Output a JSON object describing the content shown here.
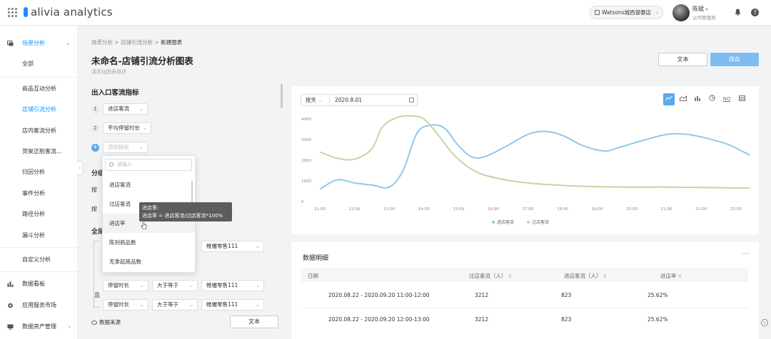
{
  "header": {
    "logo": "alivia analytics",
    "store": "Watsons城西银泰店",
    "user_name": "陈斌",
    "user_role": "公司管理员"
  },
  "sidebar": {
    "items": [
      {
        "label": "场景分析",
        "type": "group",
        "active": true
      },
      {
        "label": "全部",
        "type": "sub"
      },
      {
        "label": "商品互动分析",
        "type": "sub"
      },
      {
        "label": "店铺引流分析",
        "type": "sub",
        "active": true
      },
      {
        "label": "店内客流分析",
        "type": "sub"
      },
      {
        "label": "货架正脸客流...",
        "type": "sub"
      },
      {
        "label": "归因分析",
        "type": "sub"
      },
      {
        "label": "事件分析",
        "type": "sub"
      },
      {
        "label": "路径分析",
        "type": "sub"
      },
      {
        "label": "漏斗分析",
        "type": "sub"
      },
      {
        "label": "自定义分析",
        "type": "sub"
      },
      {
        "label": "数据看板",
        "type": "top"
      },
      {
        "label": "应用服务市场",
        "type": "top"
      },
      {
        "label": "数据资产管理",
        "type": "top"
      }
    ]
  },
  "breadcrumb": {
    "items": [
      "场景分析",
      "店铺引流分析",
      "新建图表"
    ],
    "sep": ">"
  },
  "page": {
    "title": "未命名-店铺引流分析图表",
    "desc_placeholder": "请添加图表描述",
    "text_btn": "文本",
    "save_btn": "保存"
  },
  "metrics": {
    "section_title": "出入口客流指标",
    "items": [
      {
        "num": "1",
        "label": "进店客流"
      },
      {
        "num": "2",
        "label": "平均停留时长"
      }
    ],
    "add_placeholder": "添加指标"
  },
  "dropdown": {
    "search_placeholder": "请输入",
    "options": [
      "进店客流",
      "过店客流",
      "进店率",
      "陈列商品数",
      "无拿起商品数"
    ],
    "hover_index": 2
  },
  "tooltip": {
    "line1": "进店率:",
    "line2": "进店率 = 进店客流/过店客流*100%"
  },
  "left_partial": {
    "group_label": "分组",
    "by1": "按",
    "by2": "按",
    "global_label": "全局",
    "and_label": "且"
  },
  "filters": [
    {
      "field": "",
      "op": "",
      "value": "帷幄零售111"
    },
    {
      "field": "停留时长",
      "op": "大于等于",
      "value": "帷幄零售111"
    },
    {
      "field": "停留时长",
      "op": "大于等于",
      "value": "帷幄零售111"
    }
  ],
  "data_source": "数据来源",
  "bottom_text_btn": "文本",
  "chart_controls": {
    "granularity": "按天",
    "date": "2020.8.01",
    "types": [
      "line-chart-icon",
      "area-chart-icon",
      "bar-chart-icon",
      "pie-chart-icon",
      "number-icon",
      "table-icon"
    ],
    "number_label": "NO"
  },
  "chart_data": {
    "type": "line",
    "x": [
      "11:00",
      "12:00",
      "13:00",
      "14:00",
      "15:00",
      "16:00",
      "17:00",
      "18:00",
      "19:00",
      "20:00",
      "21:00",
      "22:00",
      "23:00"
    ],
    "ylim": [
      0,
      4000
    ],
    "yticks": [
      "0",
      "1000",
      "2000",
      "3000",
      "4000"
    ],
    "legend_position": "bottom",
    "series": [
      {
        "name": "进店客流",
        "color": "#8fc8ec",
        "points": [
          [
            11.0,
            600
          ],
          [
            11.5,
            1050
          ],
          [
            12.0,
            900
          ],
          [
            12.5,
            800
          ],
          [
            13.0,
            700
          ],
          [
            13.4,
            1500
          ],
          [
            13.8,
            3300
          ],
          [
            14.2,
            3700
          ],
          [
            14.6,
            3550
          ],
          [
            15.0,
            2700
          ],
          [
            15.4,
            2150
          ],
          [
            15.8,
            2200
          ],
          [
            16.4,
            2700
          ],
          [
            17.0,
            3250
          ],
          [
            17.5,
            3400
          ],
          [
            18.0,
            3200
          ],
          [
            18.6,
            2700
          ],
          [
            19.2,
            2450
          ],
          [
            19.6,
            2600
          ],
          [
            20.2,
            2900
          ],
          [
            21.0,
            3250
          ],
          [
            21.6,
            3250
          ],
          [
            22.2,
            3050
          ],
          [
            22.8,
            2750
          ],
          [
            23.4,
            2250
          ]
        ]
      },
      {
        "name": "过店客流",
        "color": "#c7d4a4",
        "points": [
          [
            11.0,
            2400
          ],
          [
            11.5,
            2100
          ],
          [
            12.0,
            2050
          ],
          [
            12.5,
            2550
          ],
          [
            12.8,
            3600
          ],
          [
            13.2,
            4050
          ],
          [
            13.6,
            4150
          ],
          [
            14.0,
            4000
          ],
          [
            14.4,
            3250
          ],
          [
            14.9,
            2200
          ],
          [
            15.5,
            1450
          ],
          [
            16.2,
            1100
          ],
          [
            17.0,
            900
          ],
          [
            18.0,
            780
          ],
          [
            19.0,
            720
          ],
          [
            20.0,
            700
          ],
          [
            21.0,
            700
          ],
          [
            22.0,
            680
          ],
          [
            23.4,
            650
          ]
        ]
      }
    ]
  },
  "table": {
    "title": "数据明细",
    "more": "···",
    "columns": [
      "日期",
      "过店客流（人）",
      "进店客流（人）",
      "进店率"
    ],
    "rows": [
      [
        "2020.08.22 - 2020.09.20  11:00-12:00",
        "3212",
        "823",
        "25.62%"
      ],
      [
        "2020.08.22 - 2020.09.20  12:00-13:00",
        "3212",
        "823",
        "25.62%"
      ]
    ]
  }
}
